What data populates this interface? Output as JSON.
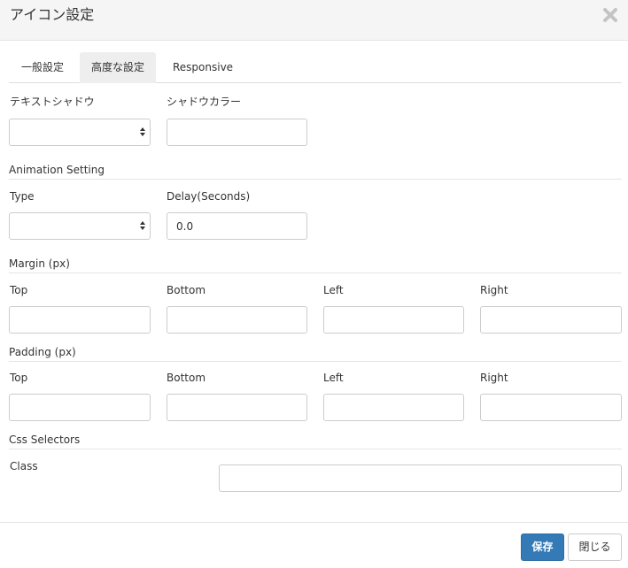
{
  "dialog": {
    "title": "アイコン設定"
  },
  "tabs": [
    {
      "label": "一般設定"
    },
    {
      "label": "高度な設定"
    },
    {
      "label": "Responsive"
    }
  ],
  "text_shadow": {
    "label": "テキストシャドウ",
    "value": ""
  },
  "shadow_color": {
    "label": "シャドウカラー",
    "value": ""
  },
  "animation": {
    "section": "Animation Setting",
    "type_label": "Type",
    "type_value": "",
    "delay_label": "Delay(Seconds)",
    "delay_value": "0.0"
  },
  "margin": {
    "section": "Margin (px)",
    "top_label": "Top",
    "bottom_label": "Bottom",
    "left_label": "Left",
    "right_label": "Right",
    "top": "",
    "bottom": "",
    "left": "",
    "right": ""
  },
  "padding": {
    "section": "Padding (px)",
    "top_label": "Top",
    "bottom_label": "Bottom",
    "left_label": "Left",
    "right_label": "Right",
    "top": "",
    "bottom": "",
    "left": "",
    "right": ""
  },
  "css": {
    "section": "Css Selectors",
    "class_label": "Class",
    "class_value": ""
  },
  "footer": {
    "save_label": "保存",
    "close_label": "閉じる"
  },
  "colors": {
    "primary": "#337ab7",
    "header_bg": "#f5f5f5",
    "border": "#cccccc"
  },
  "icons": {
    "close": "close-icon",
    "select_arrows": "select-arrows-icon"
  }
}
